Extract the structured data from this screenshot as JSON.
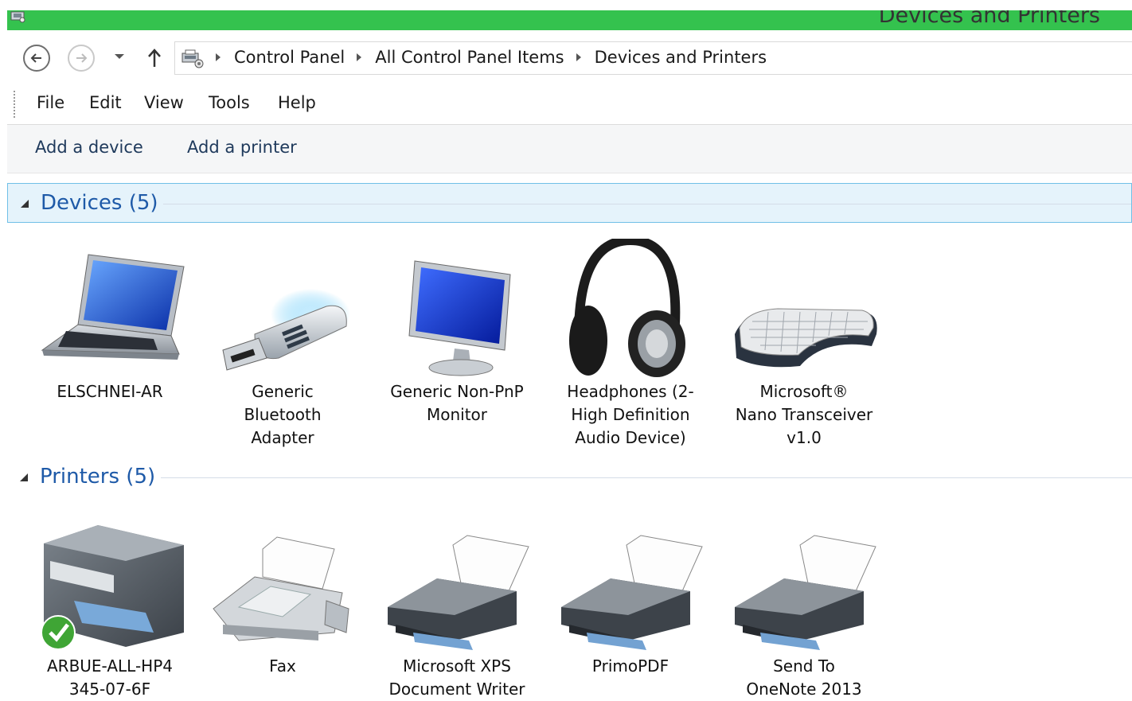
{
  "window": {
    "title": "Devices and Printers",
    "title_bar_color": "#34c24e"
  },
  "nav": {
    "back_icon": "back-arrow-icon",
    "forward_icon": "forward-arrow-icon",
    "recent_icon": "chevron-down-icon",
    "up_icon": "up-arrow-icon",
    "breadcrumbs": [
      "Control Panel",
      "All Control Panel Items",
      "Devices and Printers"
    ]
  },
  "menu": {
    "items": [
      "File",
      "Edit",
      "View",
      "Tools",
      "Help"
    ]
  },
  "commands": {
    "add_device": "Add a device",
    "add_printer": "Add a printer"
  },
  "groups": {
    "devices": {
      "label": "Devices (5)",
      "items": [
        {
          "lines": [
            "ELSCHNEI-AR"
          ],
          "icon": "laptop-icon"
        },
        {
          "lines": [
            "Generic",
            "Bluetooth",
            "Adapter"
          ],
          "icon": "bluetooth-adapter-icon"
        },
        {
          "lines": [
            "Generic Non-PnP",
            "Monitor"
          ],
          "icon": "monitor-icon"
        },
        {
          "lines": [
            "Headphones (2-",
            "High Definition",
            "Audio Device)"
          ],
          "icon": "headphones-icon"
        },
        {
          "lines": [
            "Microsoft®",
            "Nano Transceiver",
            "v1.0"
          ],
          "icon": "keyboard-icon"
        }
      ]
    },
    "printers": {
      "label": "Printers (5)",
      "items": [
        {
          "lines": [
            "ARBUE-ALL-HP4",
            "345-07-6F"
          ],
          "icon": "multifunction-printer-icon",
          "default": true
        },
        {
          "lines": [
            "Fax"
          ],
          "icon": "fax-icon"
        },
        {
          "lines": [
            "Microsoft XPS",
            "Document Writer"
          ],
          "icon": "printer-icon"
        },
        {
          "lines": [
            "PrimoPDF"
          ],
          "icon": "printer-icon"
        },
        {
          "lines": [
            "Send To",
            "OneNote 2013"
          ],
          "icon": "printer-icon"
        }
      ]
    }
  }
}
